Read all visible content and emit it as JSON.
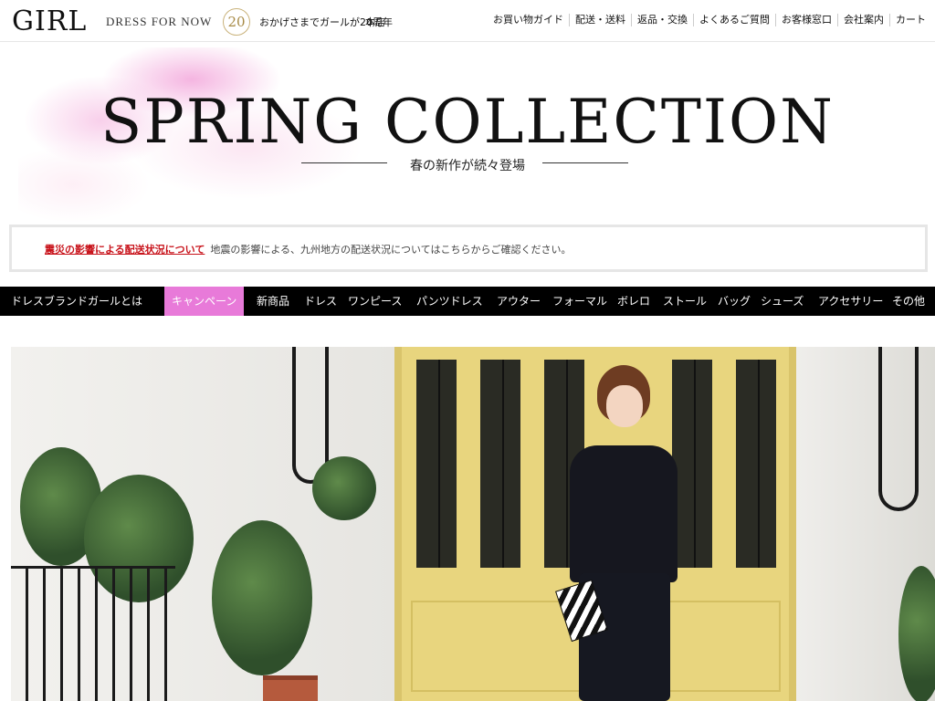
{
  "header": {
    "logo": "GIRL",
    "tagline": "DRESS FOR NOW",
    "badge_number": "20",
    "anniversary_text": "おかげさまでガールが20周年",
    "store_label": "本店",
    "util_nav": [
      "お買い物ガイド",
      "配送・送料",
      "返品・交換",
      "よくあるご質問",
      "お客様窓口",
      "会社案内",
      "カート"
    ]
  },
  "hero": {
    "title": "SPRING COLLECTION",
    "subtitle": "春の新作が続々登場"
  },
  "notice": {
    "title": "震災の影響による配送状況について",
    "text": "地震の影響による、九州地方の配送状況についてはこちらからご確認ください。"
  },
  "main_nav": {
    "items": [
      "ドレスブランドガールとは",
      "キャンペーン",
      "新商品",
      "ドレス",
      "ワンピース",
      "パンツドレス",
      "アウター",
      "フォーマル",
      "ボレロ",
      "ストール",
      "バッグ",
      "シューズ",
      "アクセサリー",
      "その他"
    ],
    "active_index": 1
  },
  "colors": {
    "accent_pink": "#e87ad9",
    "notice_red": "#c8131b",
    "nav_bg": "#000000"
  }
}
